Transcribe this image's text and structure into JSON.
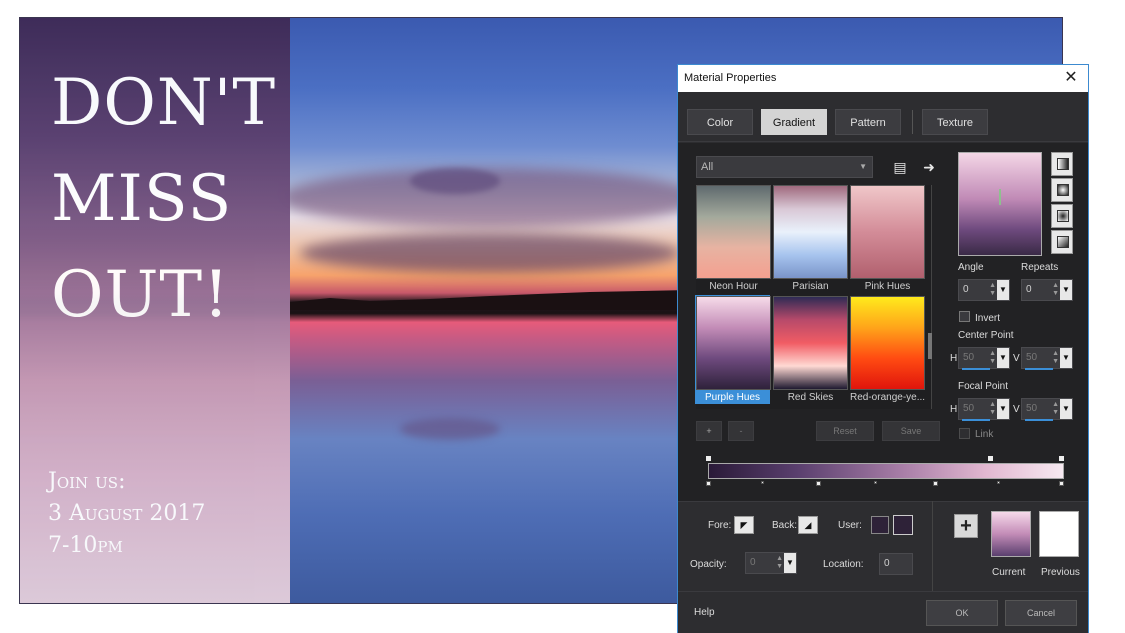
{
  "poster": {
    "headline": [
      "DON'T",
      "MISS",
      "OUT!"
    ],
    "event_lines": [
      "Join us:",
      "3 August 2017",
      "7-10pm"
    ]
  },
  "dialog": {
    "title": "Material Properties",
    "close_glyph": "✕",
    "tabs": [
      "Color",
      "Gradient",
      "Pattern",
      "Texture"
    ],
    "active_tab": "Gradient",
    "category_select": "All",
    "icons": {
      "library": "book-icon",
      "apply": "arrow-right-icon"
    },
    "swatches": [
      {
        "label": "Neon Hour",
        "colors": [
          "#5f6a6e",
          "#a3a99c",
          "#e7b3a2",
          "#f4a090"
        ]
      },
      {
        "label": "Parisian",
        "colors": [
          "#a06a7e",
          "#d9c8d6",
          "#e9f1fb",
          "#a7c4ee",
          "#7a94c9"
        ]
      },
      {
        "label": "Pink Hues",
        "colors": [
          "#f0c7c9",
          "#d38c98",
          "#b1606e"
        ]
      },
      {
        "label": "Purple Hues",
        "colors": [
          "#f6dbe9",
          "#c38cb7",
          "#6e4a7e",
          "#2f223b"
        ]
      },
      {
        "label": "Red Skies",
        "colors": [
          "#2f2b55",
          "#b84a6a",
          "#f15c64",
          "#ffd9d3",
          "#1f1a30"
        ]
      },
      {
        "label": "Red-orange-ye...",
        "colors": [
          "#ffea1c",
          "#ffa41a",
          "#ff4b12",
          "#e0150c"
        ]
      }
    ],
    "selected_swatch": "Purple Hues",
    "list_buttons": {
      "add": "+",
      "remove": "-",
      "reset": "Reset",
      "save": "Save"
    },
    "angle_label": "Angle",
    "angle_value": "0",
    "repeats_label": "Repeats",
    "repeats_value": "0",
    "invert_label": "Invert",
    "center_point_label": "Center Point",
    "center_h": "50",
    "center_v": "50",
    "focal_point_label": "Focal Point",
    "focal_h": "50",
    "focal_v": "50",
    "h_label": "H",
    "v_label": "V",
    "link_label": "Link",
    "fore_label": "Fore:",
    "back_label": "Back:",
    "user_label": "User:",
    "opacity_label": "Opacity:",
    "opacity_value": "0",
    "location_label": "Location:",
    "location_value": "0",
    "plus_glyph": "+",
    "current_label": "Current",
    "previous_label": "Previous",
    "help_label": "Help",
    "ok_label": "OK",
    "cancel_label": "Cancel"
  }
}
